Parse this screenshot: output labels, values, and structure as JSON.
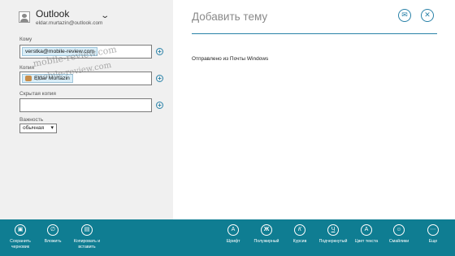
{
  "account": {
    "name": "Outlook",
    "email": "eldar.murtazin@outlook.com"
  },
  "fields": {
    "to_label": "Кому",
    "to_recipient": "verstka@mobile-review.com",
    "cc_label": "Копия",
    "cc_recipient": "Eldar Murtazin",
    "bcc_label": "Скрытая копия",
    "importance_label": "Важность",
    "importance_value": "обычная"
  },
  "watermark": {
    "line1": "mobile-review.com",
    "line2": "mobile-review.com"
  },
  "compose": {
    "subject_placeholder": "Добавить тему",
    "signature": "Отправлено из Почты Windows"
  },
  "appbar": {
    "save_draft": "Сохранить черновик",
    "attach": "Вложить",
    "copy_paste": "Копировать и вставить",
    "font": "Шрифт",
    "bold": "Полужирный",
    "italic": "Курсив",
    "underline": "Подчеркнутый",
    "text_color": "Цвет текста",
    "emoji": "Смайлики",
    "more": "Еще"
  },
  "colors": {
    "accent": "#2a82a8",
    "appbar": "#0f7d92",
    "left_pane": "#f0f0f0"
  }
}
